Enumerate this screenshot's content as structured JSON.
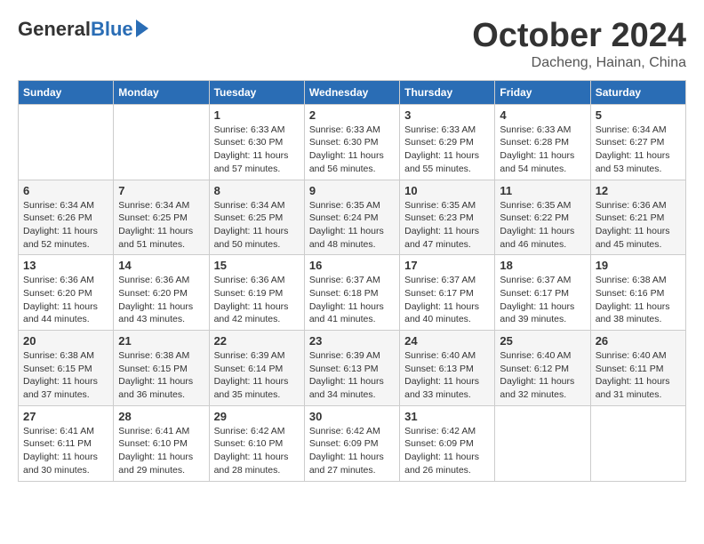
{
  "logo": {
    "general": "General",
    "blue": "Blue"
  },
  "title": "October 2024",
  "location": "Dacheng, Hainan, China",
  "headers": [
    "Sunday",
    "Monday",
    "Tuesday",
    "Wednesday",
    "Thursday",
    "Friday",
    "Saturday"
  ],
  "weeks": [
    [
      {
        "day": "",
        "detail": ""
      },
      {
        "day": "",
        "detail": ""
      },
      {
        "day": "1",
        "detail": "Sunrise: 6:33 AM\nSunset: 6:30 PM\nDaylight: 11 hours\nand 57 minutes."
      },
      {
        "day": "2",
        "detail": "Sunrise: 6:33 AM\nSunset: 6:30 PM\nDaylight: 11 hours\nand 56 minutes."
      },
      {
        "day": "3",
        "detail": "Sunrise: 6:33 AM\nSunset: 6:29 PM\nDaylight: 11 hours\nand 55 minutes."
      },
      {
        "day": "4",
        "detail": "Sunrise: 6:33 AM\nSunset: 6:28 PM\nDaylight: 11 hours\nand 54 minutes."
      },
      {
        "day": "5",
        "detail": "Sunrise: 6:34 AM\nSunset: 6:27 PM\nDaylight: 11 hours\nand 53 minutes."
      }
    ],
    [
      {
        "day": "6",
        "detail": "Sunrise: 6:34 AM\nSunset: 6:26 PM\nDaylight: 11 hours\nand 52 minutes."
      },
      {
        "day": "7",
        "detail": "Sunrise: 6:34 AM\nSunset: 6:25 PM\nDaylight: 11 hours\nand 51 minutes."
      },
      {
        "day": "8",
        "detail": "Sunrise: 6:34 AM\nSunset: 6:25 PM\nDaylight: 11 hours\nand 50 minutes."
      },
      {
        "day": "9",
        "detail": "Sunrise: 6:35 AM\nSunset: 6:24 PM\nDaylight: 11 hours\nand 48 minutes."
      },
      {
        "day": "10",
        "detail": "Sunrise: 6:35 AM\nSunset: 6:23 PM\nDaylight: 11 hours\nand 47 minutes."
      },
      {
        "day": "11",
        "detail": "Sunrise: 6:35 AM\nSunset: 6:22 PM\nDaylight: 11 hours\nand 46 minutes."
      },
      {
        "day": "12",
        "detail": "Sunrise: 6:36 AM\nSunset: 6:21 PM\nDaylight: 11 hours\nand 45 minutes."
      }
    ],
    [
      {
        "day": "13",
        "detail": "Sunrise: 6:36 AM\nSunset: 6:20 PM\nDaylight: 11 hours\nand 44 minutes."
      },
      {
        "day": "14",
        "detail": "Sunrise: 6:36 AM\nSunset: 6:20 PM\nDaylight: 11 hours\nand 43 minutes."
      },
      {
        "day": "15",
        "detail": "Sunrise: 6:36 AM\nSunset: 6:19 PM\nDaylight: 11 hours\nand 42 minutes."
      },
      {
        "day": "16",
        "detail": "Sunrise: 6:37 AM\nSunset: 6:18 PM\nDaylight: 11 hours\nand 41 minutes."
      },
      {
        "day": "17",
        "detail": "Sunrise: 6:37 AM\nSunset: 6:17 PM\nDaylight: 11 hours\nand 40 minutes."
      },
      {
        "day": "18",
        "detail": "Sunrise: 6:37 AM\nSunset: 6:17 PM\nDaylight: 11 hours\nand 39 minutes."
      },
      {
        "day": "19",
        "detail": "Sunrise: 6:38 AM\nSunset: 6:16 PM\nDaylight: 11 hours\nand 38 minutes."
      }
    ],
    [
      {
        "day": "20",
        "detail": "Sunrise: 6:38 AM\nSunset: 6:15 PM\nDaylight: 11 hours\nand 37 minutes."
      },
      {
        "day": "21",
        "detail": "Sunrise: 6:38 AM\nSunset: 6:15 PM\nDaylight: 11 hours\nand 36 minutes."
      },
      {
        "day": "22",
        "detail": "Sunrise: 6:39 AM\nSunset: 6:14 PM\nDaylight: 11 hours\nand 35 minutes."
      },
      {
        "day": "23",
        "detail": "Sunrise: 6:39 AM\nSunset: 6:13 PM\nDaylight: 11 hours\nand 34 minutes."
      },
      {
        "day": "24",
        "detail": "Sunrise: 6:40 AM\nSunset: 6:13 PM\nDaylight: 11 hours\nand 33 minutes."
      },
      {
        "day": "25",
        "detail": "Sunrise: 6:40 AM\nSunset: 6:12 PM\nDaylight: 11 hours\nand 32 minutes."
      },
      {
        "day": "26",
        "detail": "Sunrise: 6:40 AM\nSunset: 6:11 PM\nDaylight: 11 hours\nand 31 minutes."
      }
    ],
    [
      {
        "day": "27",
        "detail": "Sunrise: 6:41 AM\nSunset: 6:11 PM\nDaylight: 11 hours\nand 30 minutes."
      },
      {
        "day": "28",
        "detail": "Sunrise: 6:41 AM\nSunset: 6:10 PM\nDaylight: 11 hours\nand 29 minutes."
      },
      {
        "day": "29",
        "detail": "Sunrise: 6:42 AM\nSunset: 6:10 PM\nDaylight: 11 hours\nand 28 minutes."
      },
      {
        "day": "30",
        "detail": "Sunrise: 6:42 AM\nSunset: 6:09 PM\nDaylight: 11 hours\nand 27 minutes."
      },
      {
        "day": "31",
        "detail": "Sunrise: 6:42 AM\nSunset: 6:09 PM\nDaylight: 11 hours\nand 26 minutes."
      },
      {
        "day": "",
        "detail": ""
      },
      {
        "day": "",
        "detail": ""
      }
    ]
  ]
}
